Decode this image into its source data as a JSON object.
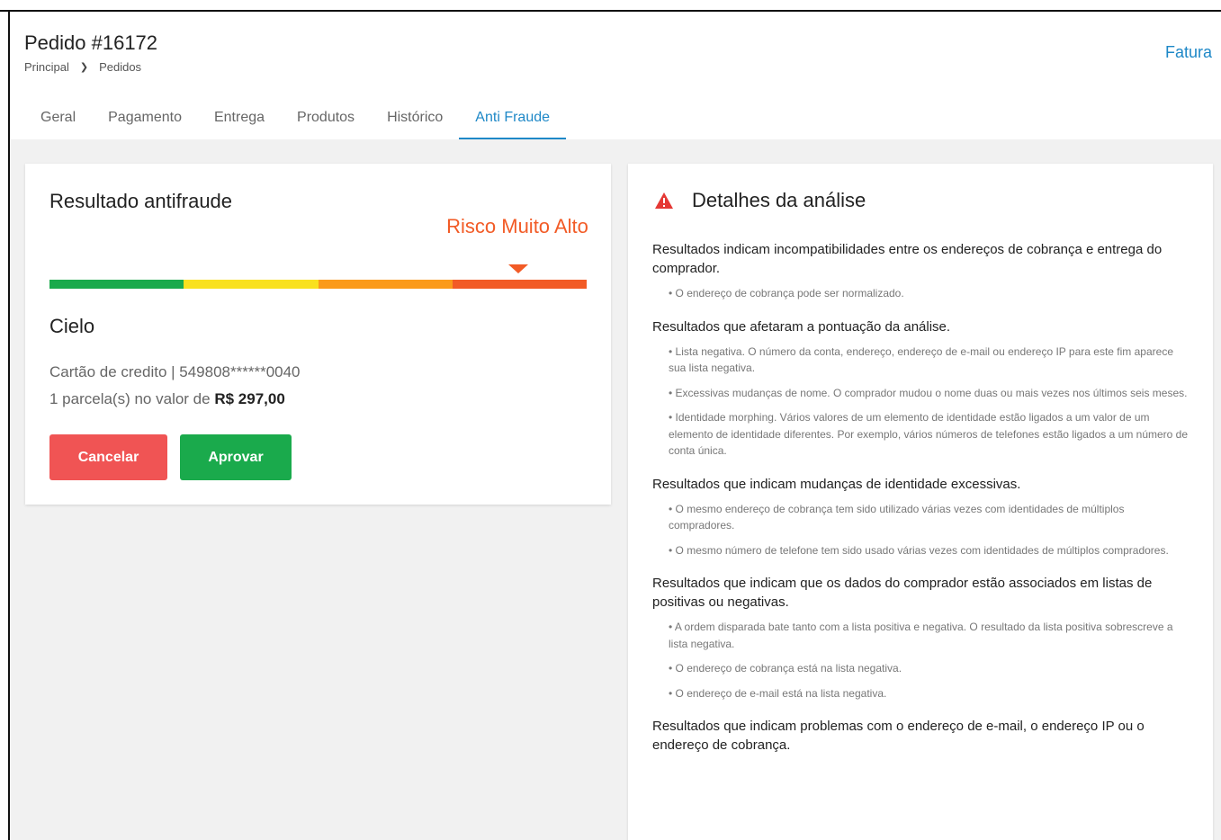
{
  "header": {
    "order_title": "Pedido #16172",
    "breadcrumb": [
      "Principal",
      "Pedidos"
    ],
    "invoice_link": "Fatura"
  },
  "tabs": [
    {
      "label": "Geral",
      "active": false
    },
    {
      "label": "Pagamento",
      "active": false
    },
    {
      "label": "Entrega",
      "active": false
    },
    {
      "label": "Produtos",
      "active": false
    },
    {
      "label": "Histórico",
      "active": false
    },
    {
      "label": "Anti Fraude",
      "active": true
    }
  ],
  "result_card": {
    "title": "Resultado antifraude",
    "risk_label": "Risco Muito Alto",
    "risk_level_index": 3,
    "risk_colors": [
      "#1aaa4c",
      "#f9e11f",
      "#fb9a1a",
      "#f25b26"
    ],
    "provider": "Cielo",
    "card_info": "Cartão de credito | 549808******0040",
    "installments_prefix": "1 parcela(s) no valor de",
    "installments_amount": "R$ 297,00",
    "cancel_label": "Cancelar",
    "approve_label": "Aprovar"
  },
  "details_card": {
    "title": "Detalhes da análise",
    "sections": [
      {
        "title": "Resultados indicam incompatibilidades entre os endereços de cobrança e entrega do comprador.",
        "items": [
          "• O endereço de cobrança pode ser normalizado."
        ]
      },
      {
        "title": "Resultados que afetaram a pontuação da análise.",
        "items": [
          "• Lista negativa. O número da conta, endereço, endereço de e-mail ou endereço IP para este fim aparece sua lista negativa.",
          "• Excessivas mudanças de nome. O comprador mudou o nome duas ou mais vezes nos últimos seis meses.",
          "• Identidade morphing. Vários valores de um elemento de identidade estão ligados a um valor de um elemento de identidade diferentes. Por exemplo, vários números de telefones estão ligados a um número de conta única."
        ]
      },
      {
        "title": "Resultados que indicam mudanças de identidade excessivas.",
        "items": [
          "• O mesmo endereço de cobrança tem sido utilizado várias vezes com identidades de múltiplos compradores.",
          "• O mesmo número de telefone tem sido usado várias vezes com identidades de múltiplos compradores."
        ]
      },
      {
        "title": "Resultados que indicam que os dados do comprador estão associados em listas de positivas ou negativas.",
        "items": [
          "• A ordem disparada bate tanto com a lista positiva e negativa. O resultado da lista positiva sobrescreve a lista negativa.",
          "• O endereço de cobrança está na lista negativa.",
          "• O endereço de e-mail está na lista negativa."
        ]
      },
      {
        "title": "Resultados que indicam problemas com o endereço de e-mail, o endereço IP ou o endereço de cobrança.",
        "items": []
      }
    ]
  }
}
